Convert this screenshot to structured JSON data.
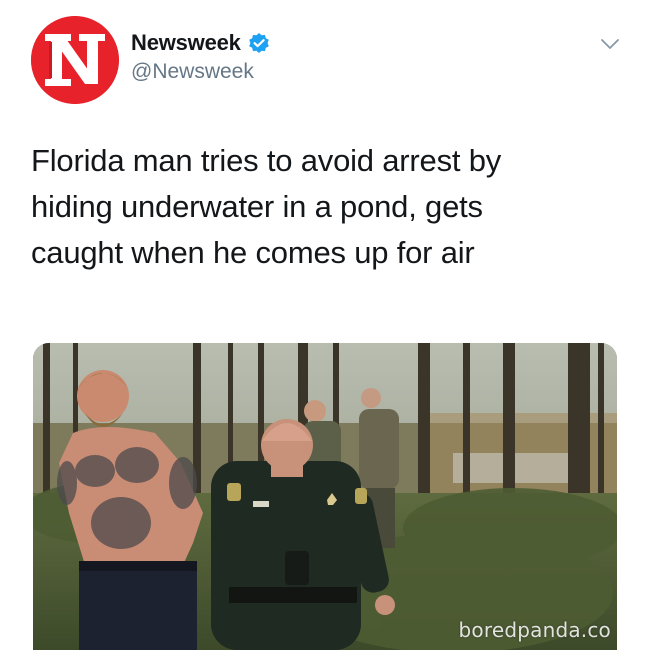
{
  "account": {
    "display_name": "Newsweek",
    "handle": "@Newsweek",
    "verified": true,
    "avatar_icon": "newsweek-logo-icon",
    "avatar_color": "#e8222b"
  },
  "tweet": {
    "lines": [
      "Florida man tries to avoid arrest by",
      "hiding underwater in a pond, gets",
      "caught when he comes up for air"
    ]
  },
  "media": {
    "watermark": "boredpanda.co"
  },
  "colors": {
    "verified_blue": "#1da1f2",
    "handle_gray": "#657786",
    "text": "#14171a"
  },
  "icons": {
    "menu": "chevron-down-icon",
    "verified": "verified-badge-icon"
  }
}
